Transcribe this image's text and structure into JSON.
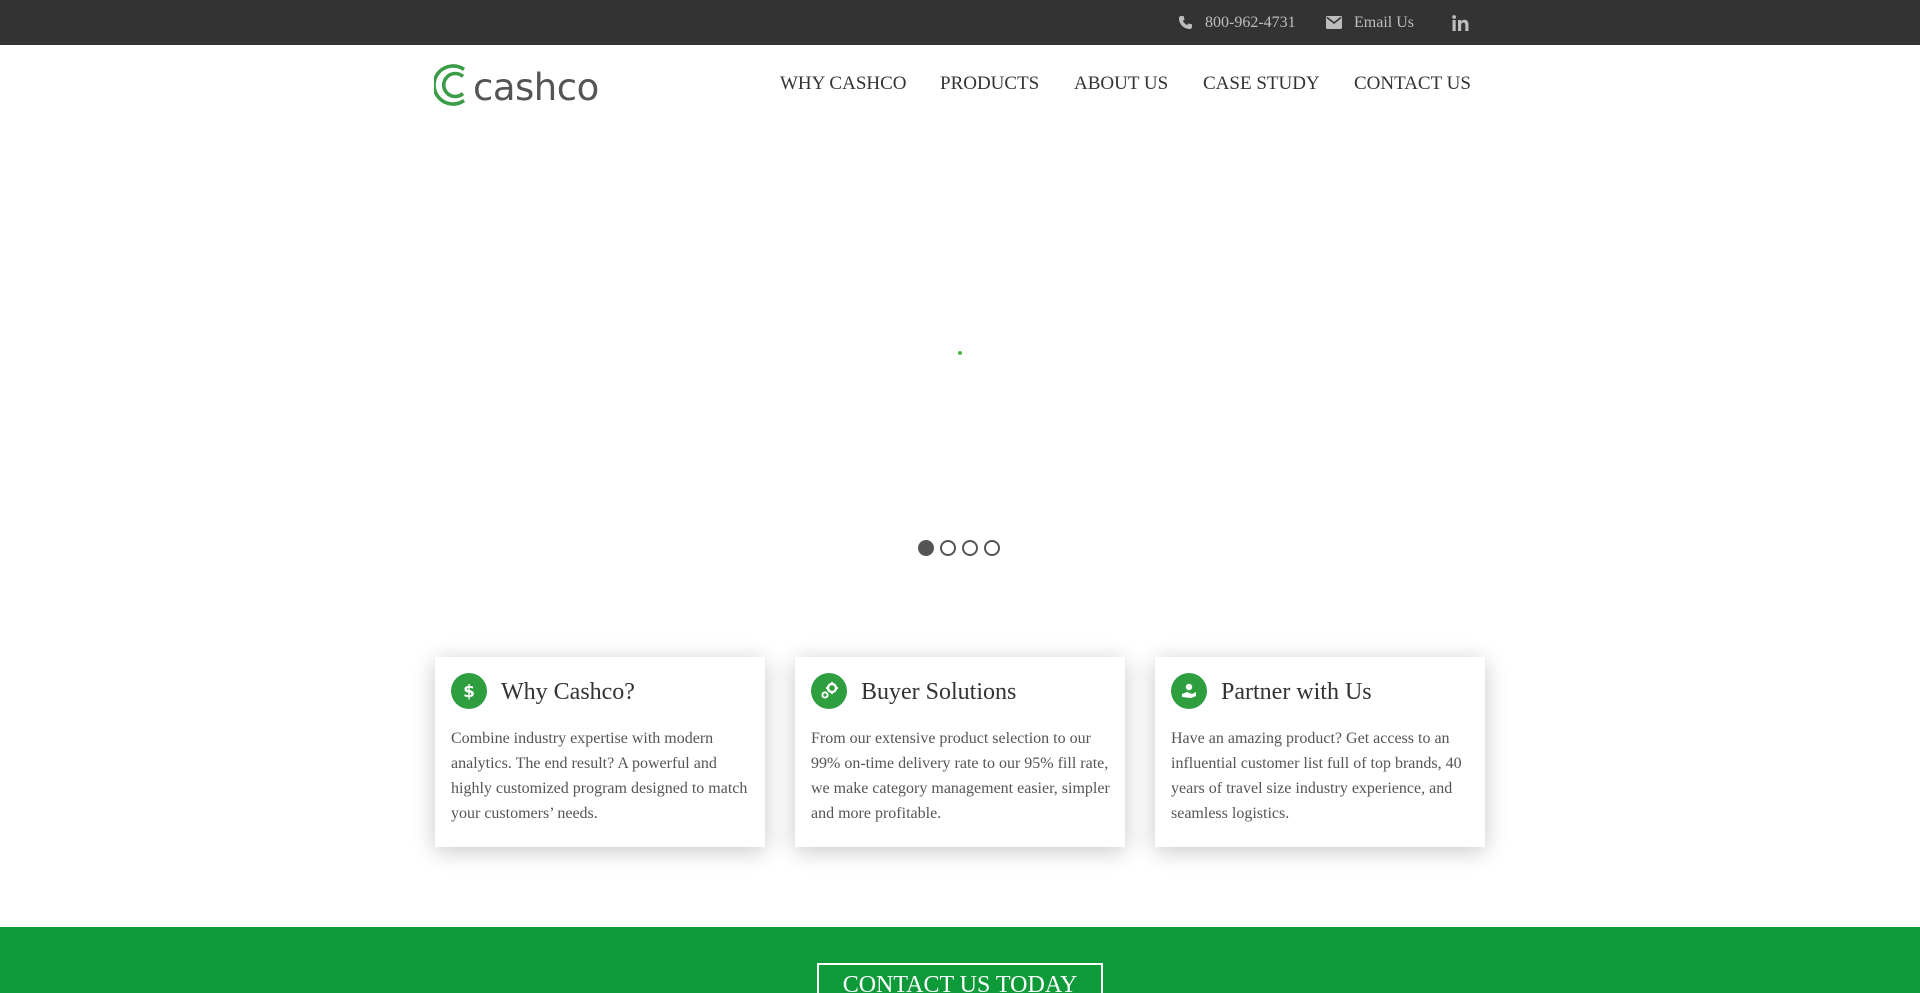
{
  "topbar": {
    "phone": "800-962-4731",
    "phone_icon": "phone-icon",
    "email": "Email Us",
    "email_icon": "envelope-icon",
    "social_icon": "linkedin-icon"
  },
  "header": {
    "logo_text": "cashco",
    "nav": [
      "WHY CASHCO",
      "PRODUCTS",
      "ABOUT US",
      "CASE STUDY",
      "CONTACT US"
    ]
  },
  "slider": {
    "slides_total": 4,
    "active_slide": 1
  },
  "cards": [
    {
      "title": "Why Cashco?",
      "icon": "dollar-icon",
      "text": "Combine industry expertise with modern analytics. The end result? A powerful and highly customized program designed to match your customers’ needs."
    },
    {
      "title": "Buyer Solutions",
      "icon": "gears-icon",
      "text": "From our extensive product selection to our 99% on-time delivery rate to our 95% fill rate, we make category management easier, simpler and more profitable."
    },
    {
      "title": "Partner with Us",
      "icon": "handshake-icon",
      "text": "Have an amazing product? Get access to an influential customer list full of top brands, 40 years of travel size industry experience, and seamless logistics."
    }
  ],
  "cta": {
    "label": "CONTACT US TODAY"
  },
  "colors": {
    "topbar_bg": "#333333",
    "brand_green": "#2e9e3f",
    "cta_bg": "#0f9a3a"
  }
}
